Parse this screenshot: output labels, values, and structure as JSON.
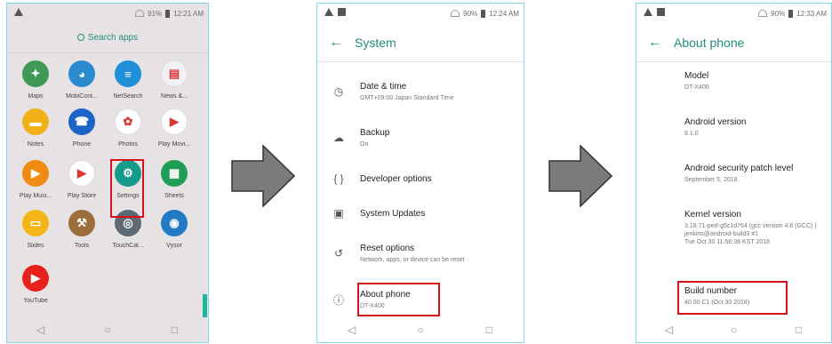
{
  "phone1": {
    "status": {
      "battery": "91%",
      "time": "12:21 AM"
    },
    "search_label": "Search apps",
    "apps": [
      {
        "label": "Maps",
        "icon": "maps-icon",
        "color": "#3f9a57",
        "glyph": "✦"
      },
      {
        "label": "MobiCont...",
        "icon": "mobicontrol-icon",
        "color": "#2a8ccf",
        "glyph": "◕"
      },
      {
        "label": "NetSearch",
        "icon": "netsearch-icon",
        "color": "#1e8ed8",
        "glyph": "≡"
      },
      {
        "label": "News &...",
        "icon": "news-icon",
        "color": "#f0f2f7",
        "glyph": "▤"
      },
      {
        "label": "Notes",
        "icon": "notes-icon",
        "color": "#f2b01b",
        "glyph": "▬"
      },
      {
        "label": "Phone",
        "icon": "phone-icon",
        "color": "#1d64c9",
        "glyph": "☎"
      },
      {
        "label": "Photos",
        "icon": "photos-icon",
        "color": "#ffffff",
        "glyph": "✿"
      },
      {
        "label": "Play Movi...",
        "icon": "play-movies-icon",
        "color": "#ffffff",
        "glyph": "▶"
      },
      {
        "label": "Play Musi...",
        "icon": "play-music-icon",
        "color": "#f08a13",
        "glyph": "▶"
      },
      {
        "label": "Play Store",
        "icon": "play-store-icon",
        "color": "#ffffff",
        "glyph": "▶"
      },
      {
        "label": "Settings",
        "icon": "settings-gear-icon",
        "color": "#159a8c",
        "glyph": "⚙"
      },
      {
        "label": "Sheets",
        "icon": "sheets-icon",
        "color": "#1e9d57",
        "glyph": "▦"
      },
      {
        "label": "Slides",
        "icon": "slides-icon",
        "color": "#f3b616",
        "glyph": "▭"
      },
      {
        "label": "Tools",
        "icon": "tools-icon",
        "color": "#9e6e3a",
        "glyph": "⚒"
      },
      {
        "label": "TouchCal...",
        "icon": "touchcal-icon",
        "color": "#5d6b77",
        "glyph": "◎"
      },
      {
        "label": "Vysor",
        "icon": "vysor-icon",
        "color": "#2279c4",
        "glyph": "◉"
      },
      {
        "label": "YouTube",
        "icon": "youtube-icon",
        "color": "#e7221d",
        "glyph": "▶"
      }
    ]
  },
  "phone2": {
    "status": {
      "battery": "90%",
      "time": "12:24 AM"
    },
    "title": "System",
    "rows": [
      {
        "title": "Date & time",
        "sub": "GMT+09:00 Japan Standard Time",
        "icon": "clock-icon",
        "glyph": "◷"
      },
      {
        "title": "Backup",
        "sub": "On",
        "icon": "cloud-upload-icon",
        "glyph": "☁"
      },
      {
        "title": "Developer options",
        "sub": "",
        "icon": "code-braces-icon",
        "glyph": "{ }"
      },
      {
        "title": "System Updates",
        "sub": "",
        "icon": "system-update-icon",
        "glyph": "▣"
      },
      {
        "title": "Reset options",
        "sub": "Network, apps, or device can be reset",
        "icon": "reset-icon",
        "glyph": "↺"
      },
      {
        "title": "About phone",
        "sub": "DT-X400",
        "icon": "info-icon",
        "glyph": "ⓘ"
      }
    ]
  },
  "phone3": {
    "status": {
      "battery": "90%",
      "time": "12:33 AM"
    },
    "title": "About phone",
    "items": [
      {
        "title": "Model",
        "sub": "DT-X400"
      },
      {
        "title": "Android version",
        "sub": "8.1.0"
      },
      {
        "title": "Android security patch level",
        "sub": "September 5, 2018"
      },
      {
        "title": "Kernel version",
        "sub": "3.18.71-perf-g5c1d764 (gcc version 4.8 (GCC) )\njenkins@android-build3 #1\nTue Oct 30 11:56:38 KST 2018"
      },
      {
        "title": "Build number",
        "sub": "40.00 C1 (Oct 30 2018)"
      }
    ]
  },
  "nav": {
    "back": "◁",
    "home": "○",
    "recent": "□"
  },
  "colors": {
    "accent": "#1f8d79",
    "highlight": "#d6131a",
    "frame": "#7fd9e8",
    "arrow_fill": "#7b7b7b"
  }
}
